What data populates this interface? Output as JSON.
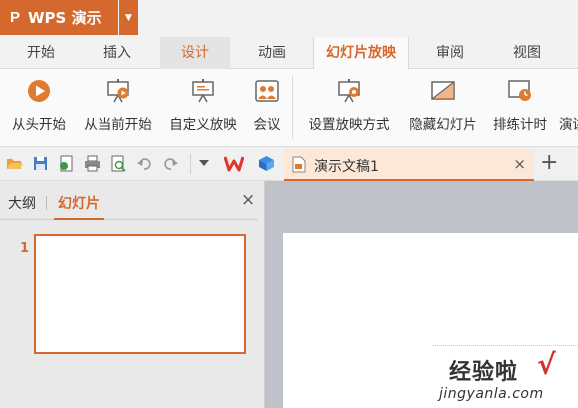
{
  "app": {
    "title": "WPS 演示",
    "logo": "P"
  },
  "tabs": [
    {
      "label": "开始"
    },
    {
      "label": "插入"
    },
    {
      "label": "设计"
    },
    {
      "label": "动画"
    },
    {
      "label": "幻灯片放映"
    },
    {
      "label": "审阅"
    },
    {
      "label": "视图"
    }
  ],
  "ribbon": [
    {
      "label": "从头开始",
      "icon": "play-circle-icon"
    },
    {
      "label": "从当前开始",
      "icon": "screen-play-icon"
    },
    {
      "label": "自定义放映",
      "icon": "custom-show-icon"
    },
    {
      "label": "会议",
      "icon": "meeting-icon"
    },
    {
      "label": "设置放映方式",
      "icon": "setup-show-icon"
    },
    {
      "label": "隐藏幻灯片",
      "icon": "hide-slide-icon"
    },
    {
      "label": "排练计时",
      "icon": "rehearse-timing-icon"
    },
    {
      "label": "演讲",
      "icon": "presenter-icon"
    }
  ],
  "document": {
    "tab_title": "演示文稿1",
    "close": "×",
    "add": "+"
  },
  "panel": {
    "outline_tab": "大纲",
    "slides_tab": "幻灯片",
    "close": "×",
    "slide_number": "1"
  },
  "watermark": {
    "text": "经验啦",
    "check": "√",
    "url": "jingyanla.com"
  },
  "colors": {
    "accent": "#d5692d",
    "ribbon_bg": "#fafafa",
    "canvas_bg": "#bfc3c9"
  }
}
